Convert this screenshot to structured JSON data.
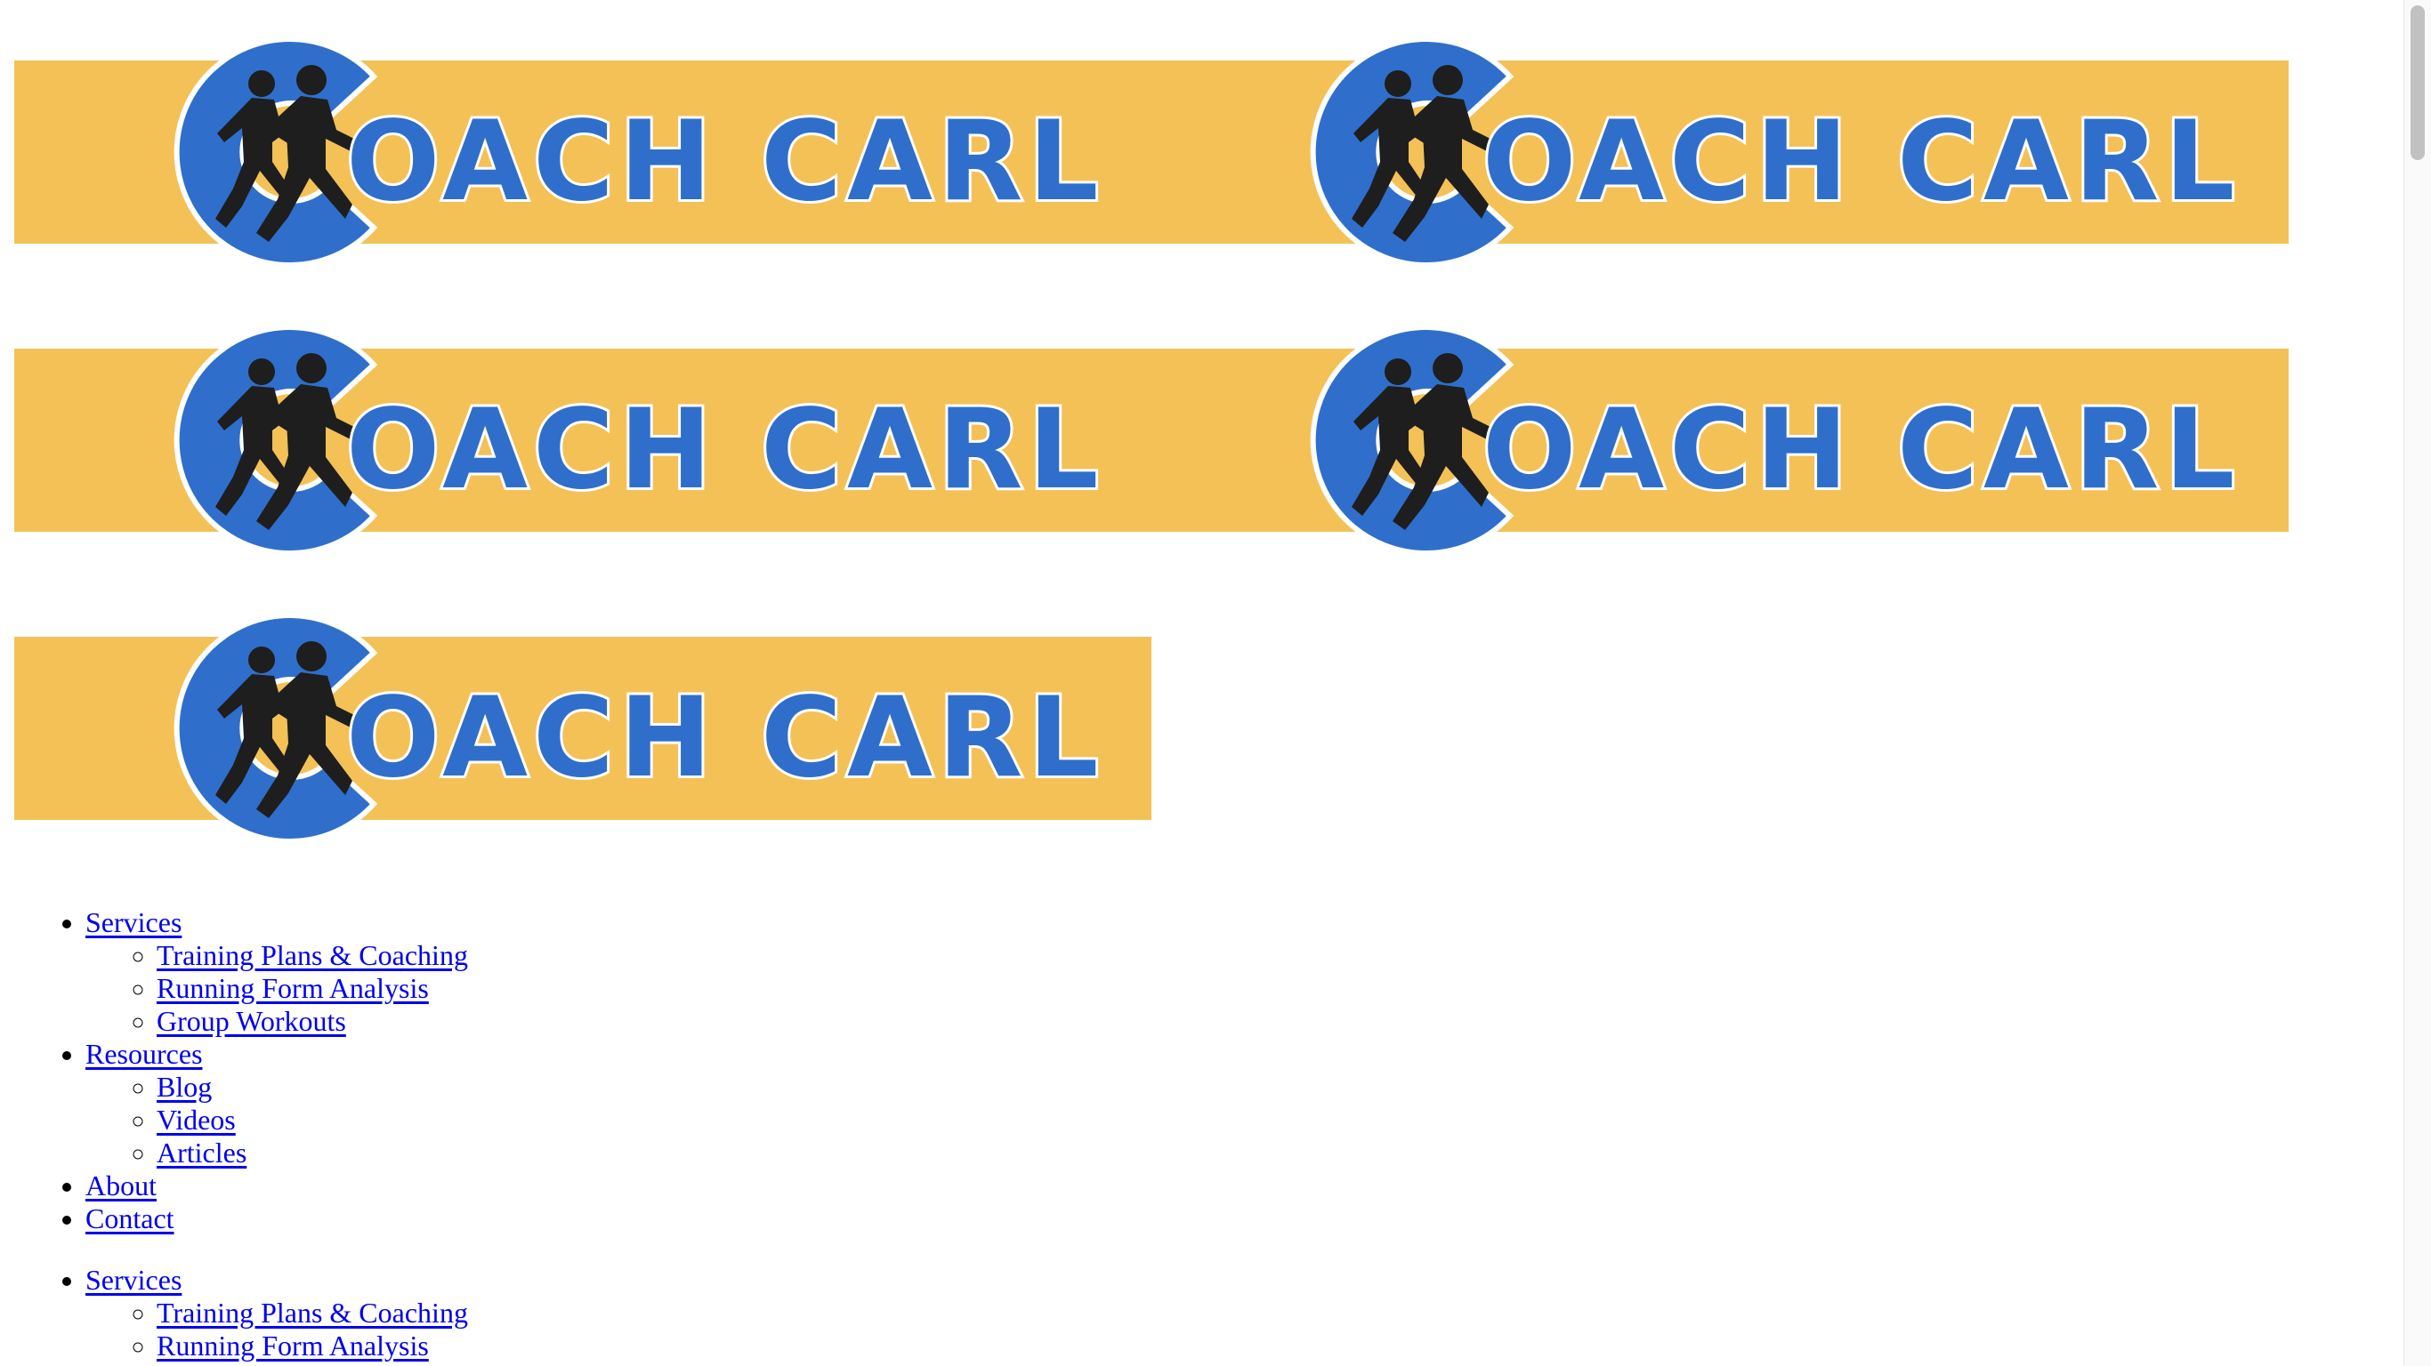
{
  "logos": [
    {
      "alt": "Coach Carl logo",
      "text": "OACH CARL",
      "band_color": "#F4C157",
      "brand_color": "#2F6FCB",
      "figure_color": "#1E1E1E"
    },
    {
      "alt": "Coach Carl logo",
      "text": "OACH CARL",
      "band_color": "#F4C157",
      "brand_color": "#2F6FCB",
      "figure_color": "#1E1E1E"
    },
    {
      "alt": "Coach Carl logo",
      "text": "OACH CARL",
      "band_color": "#F4C157",
      "brand_color": "#2F6FCB",
      "figure_color": "#1E1E1E"
    },
    {
      "alt": "Coach Carl logo",
      "text": "OACH CARL",
      "band_color": "#F4C157",
      "brand_color": "#2F6FCB",
      "figure_color": "#1E1E1E"
    },
    {
      "alt": "Coach Carl logo",
      "text": "OACH CARL",
      "band_color": "#F4C157",
      "brand_color": "#2F6FCB",
      "figure_color": "#1E1E1E"
    }
  ],
  "nav": {
    "services": "Services",
    "services_items": [
      "Training Plans & Coaching",
      "Running Form Analysis",
      "Group Workouts"
    ],
    "resources": "Resources",
    "resources_items": [
      "Blog",
      "Videos",
      "Articles"
    ],
    "about": "About",
    "contact": "Contact"
  },
  "nav2": {
    "services": "Services",
    "services_items": [
      "Training Plans & Coaching",
      "Running Form Analysis"
    ]
  },
  "colors": {
    "link": "#0000EE",
    "background": "#FFFFFF",
    "scrollbar_thumb": "#C1C1C1"
  }
}
